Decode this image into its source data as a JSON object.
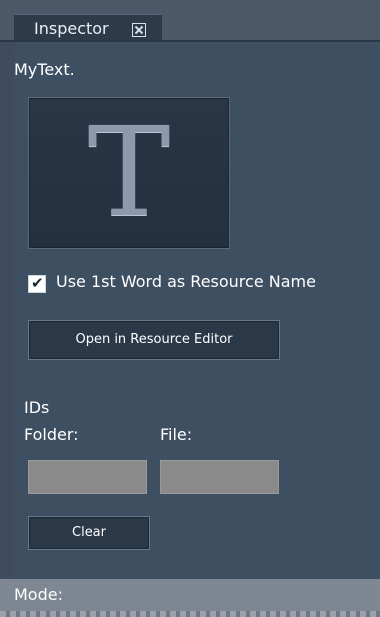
{
  "tab": {
    "label": "Inspector",
    "close_icon": "close-box-icon"
  },
  "object": {
    "name": "MyText.",
    "preview_glyph": "T"
  },
  "checkbox": {
    "label": "Use 1st Word as Resource Name",
    "checked": true
  },
  "buttons": {
    "open_editor": "Open in Resource Editor",
    "clear": "Clear"
  },
  "ids": {
    "section_title": "IDs",
    "folder_label": "Folder:",
    "file_label": "File:",
    "folder_value": "",
    "file_value": ""
  },
  "mode": {
    "label": "Mode:"
  }
}
